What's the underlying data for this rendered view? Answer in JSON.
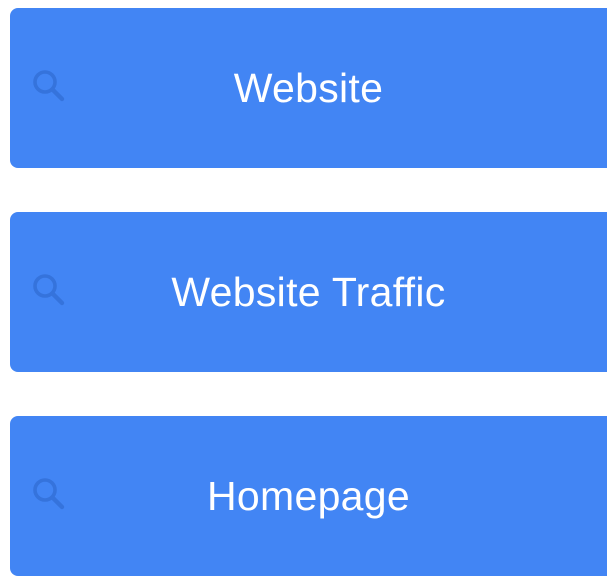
{
  "colors": {
    "row_background": "#4285F4",
    "icon_color": "#3573DC",
    "label_color": "#FFFFFF"
  },
  "suggestions": [
    {
      "label": "Website",
      "icon": "search-icon"
    },
    {
      "label": "Website Traffic",
      "icon": "search-icon"
    },
    {
      "label": "Homepage",
      "icon": "search-icon"
    }
  ]
}
